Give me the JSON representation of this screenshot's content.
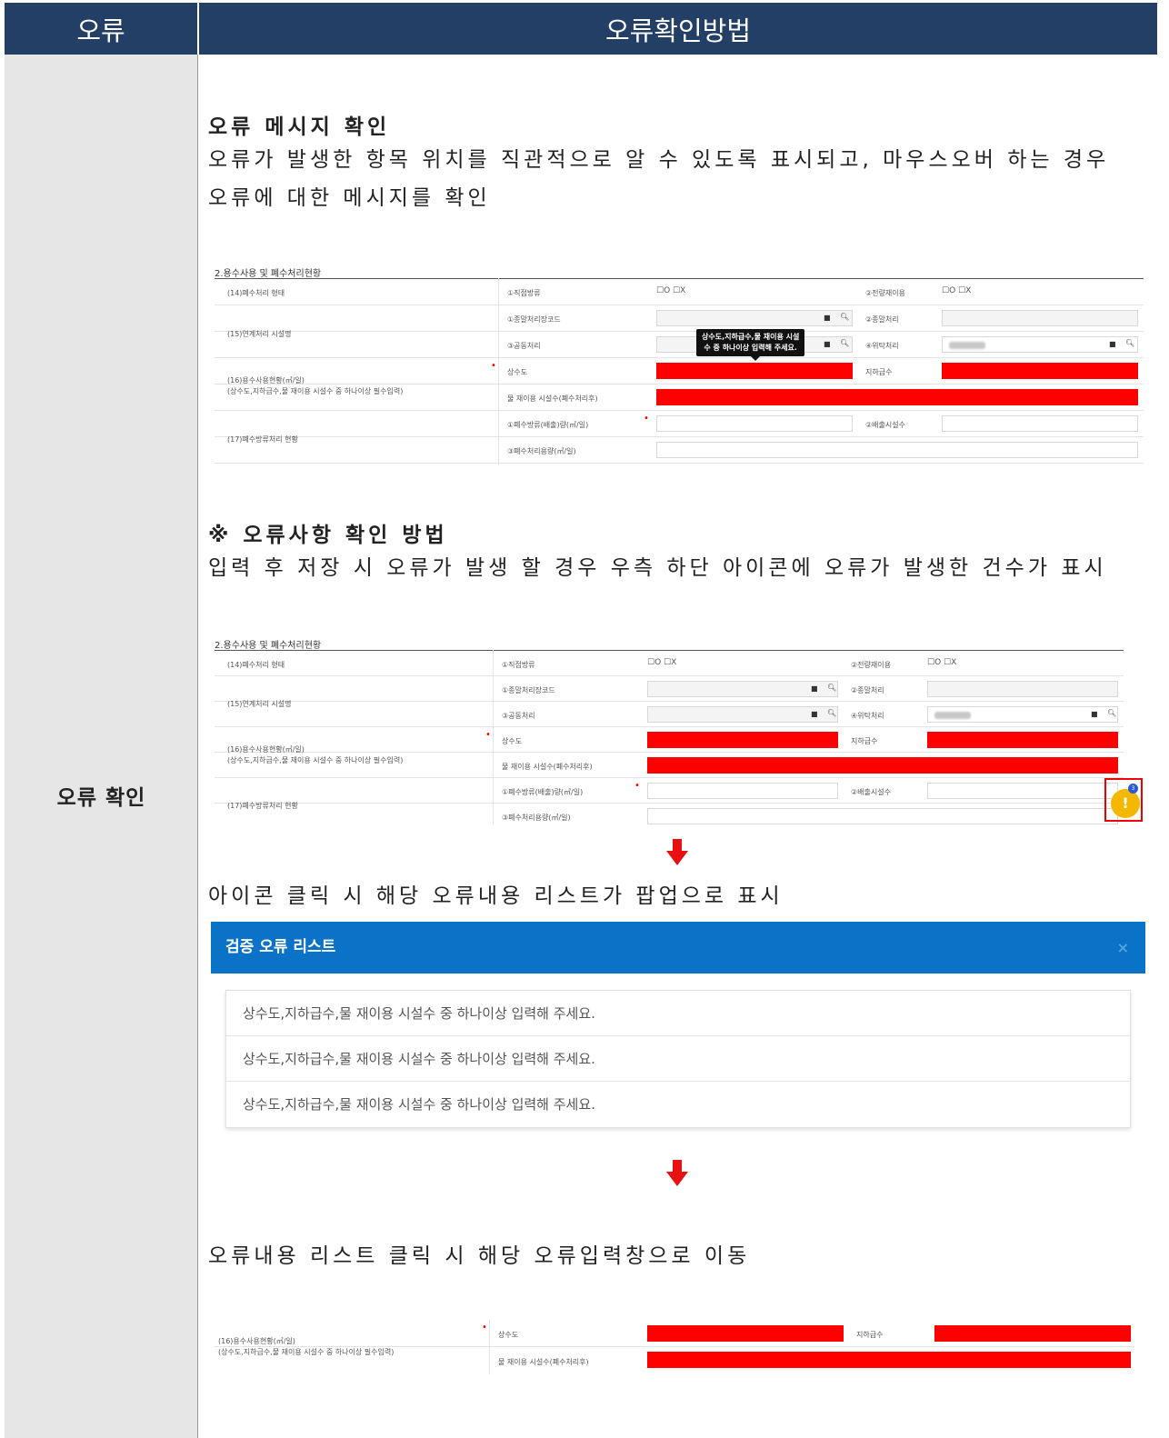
{
  "header": {
    "left": "오류",
    "right": "오류확인방법"
  },
  "left_label": "오류 확인",
  "section1": {
    "title": "오류 메시지 확인",
    "desc_line1": "오류가 발생한 항목 위치를 직관적으로 알 수 있도록 표시되고, 마우스오버 하는 경우",
    "desc_line2": "오류에 대한 메시지를 확인"
  },
  "section2": {
    "title": "※ 오류사항 확인 방법",
    "desc": "입력 후 저장 시 오류가 발생 할 경우 우측 하단 아이콘에 오류가 발생한 건수가 표시",
    "step2": "아이콘 클릭 시 해당 오류내용 리스트가 팝업으로 표시",
    "step3": "오류내용 리스트 클릭 시 해당 오류입력창으로 이동"
  },
  "form": {
    "title": "2.용수사용 및 폐수처리현황",
    "r14": "(14)폐수처리 형태",
    "r15": "(15)연계처리 시설명",
    "r16a": "(16)용수사용현황(㎥/일)",
    "r16b": "(상수도,지하급수,물 재이용 시설수 중 하나이상 필수입력)",
    "r17": "(17)폐수방류처리 현황",
    "c_direct": "①직접방류",
    "c_full_reuse": "②전량재이용",
    "c_final_code": "①종말처리장코드",
    "c_final": "②종말처리",
    "c_joint": "③공동처리",
    "c_consign": "④위탁처리",
    "c_tap": "상수도",
    "c_ground": "지하급수",
    "c_reuse": "물 재이용 시설수(폐수처리후)",
    "c_discharge": "①폐수방류(배출)량(㎥/일)",
    "c_discharge_fac": "②배출시설수",
    "c_treat": "③폐수처리용량(㎥/일)",
    "opt_o": "O",
    "opt_x": "X",
    "tooltip1": "상수도,지하급수,물 재이용 시설",
    "tooltip2": "수 중 하나이상 입력해 주세요."
  },
  "badge": {
    "count": "3",
    "symbol": "!"
  },
  "popup": {
    "title": "검증 오류 리스트",
    "close": "×",
    "items": [
      "상수도,지하급수,물 재이용 시설수 중 하나이상 입력해 주세요.",
      "상수도,지하급수,물 재이용 시설수 중 하나이상 입력해 주세요.",
      "상수도,지하급수,물 재이용 시설수 중 하나이상 입력해 주세요."
    ]
  },
  "colors": {
    "header_bg": "#243f66",
    "error_red": "#ff0000",
    "popup_blue": "#0a73c8",
    "badge_yellow": "#f5b800",
    "arrow_red": "#e81010"
  }
}
